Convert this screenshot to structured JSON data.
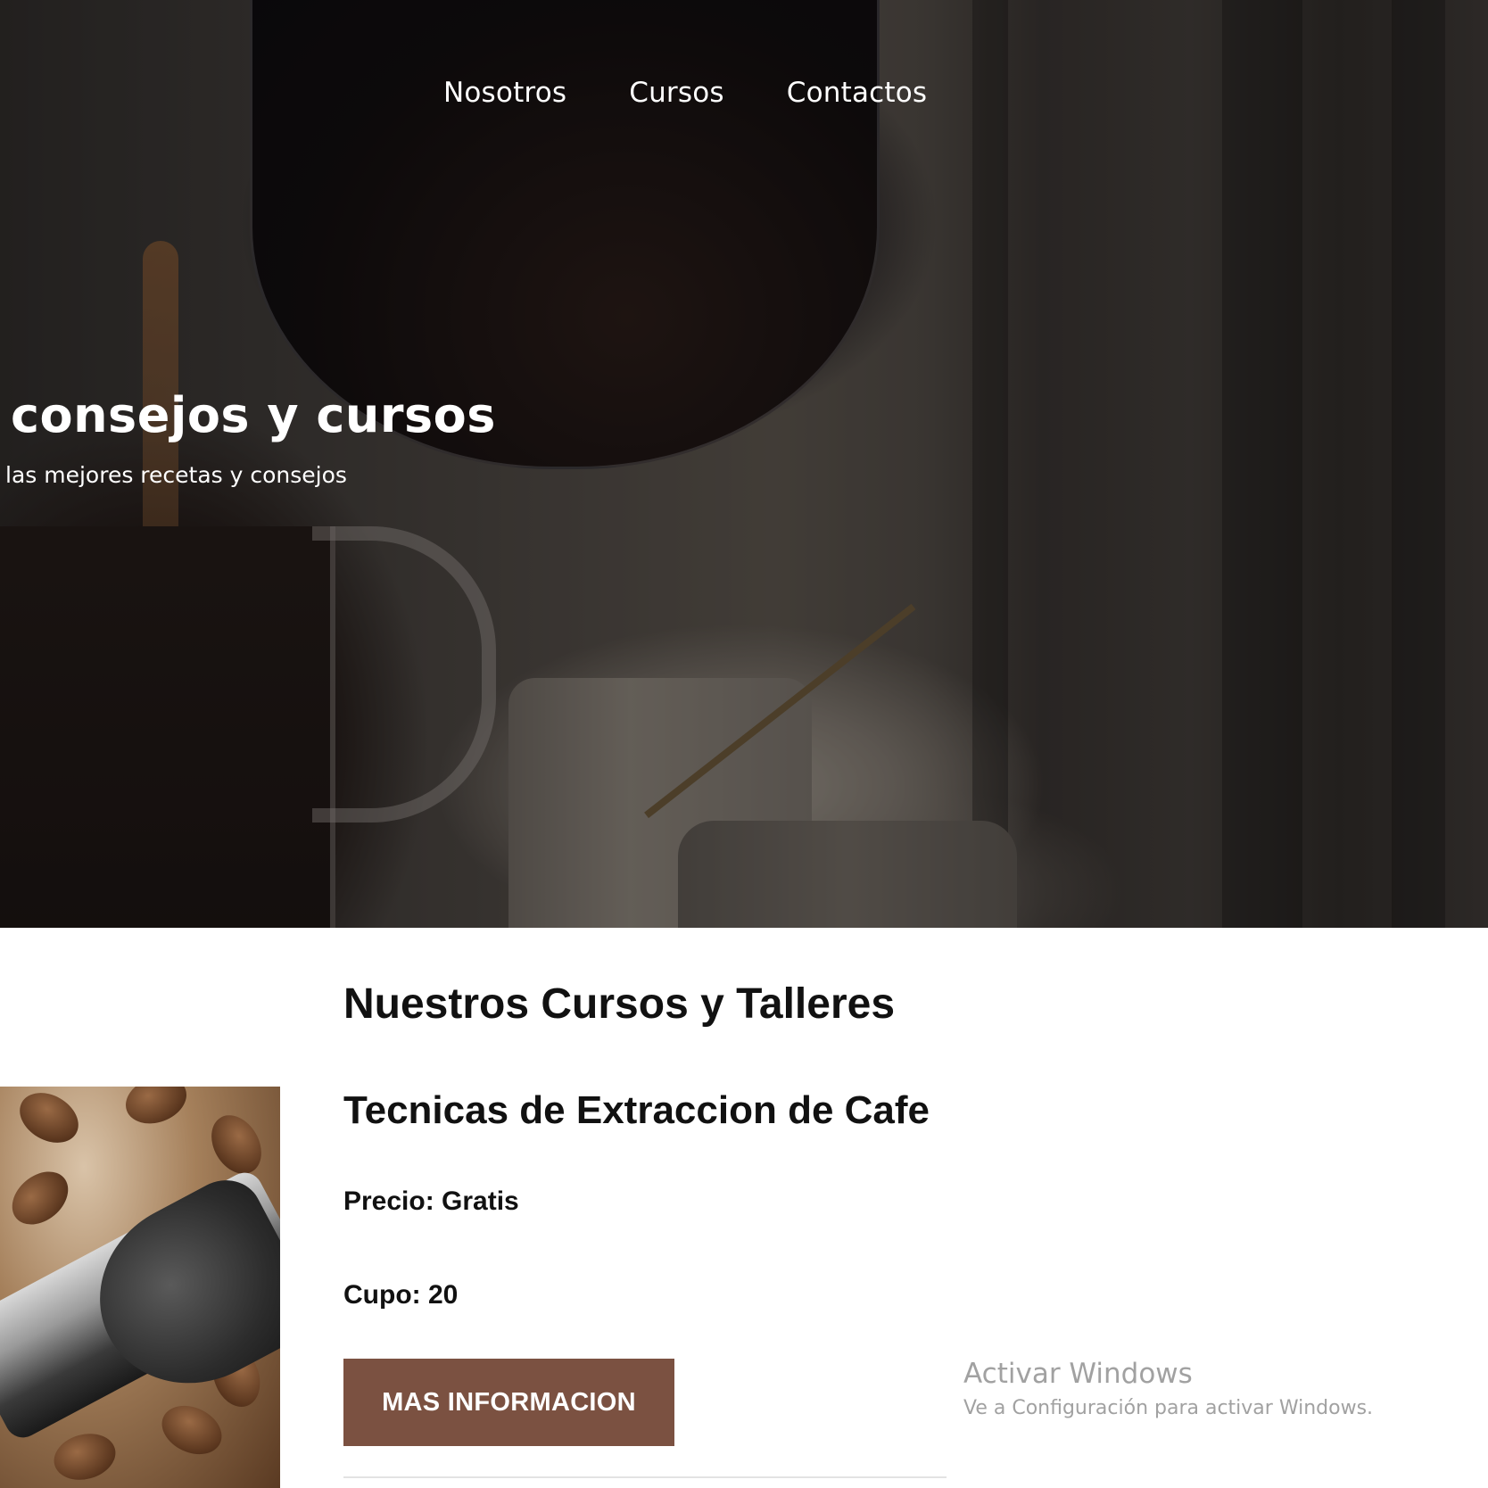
{
  "nav": {
    "items": [
      "Nosotros",
      "Cursos",
      "Contactos"
    ]
  },
  "hero": {
    "title": "consejos y cursos",
    "subtitle": "las mejores recetas y consejos"
  },
  "courses": {
    "heading": "Nuestros Cursos y Talleres",
    "items": [
      {
        "title": "Tecnicas de Extraccion de Cafe",
        "price": "Precio: Gratis",
        "cupo": "Cupo: 20",
        "button_label": "MAS INFORMACION"
      }
    ]
  },
  "windows_watermark": {
    "title": "Activar Windows",
    "subtitle": "Ve a Configuración para activar Windows."
  },
  "colors": {
    "button_background": "#7b5141",
    "text_dark": "#111111",
    "nav_text": "#ffffff"
  }
}
